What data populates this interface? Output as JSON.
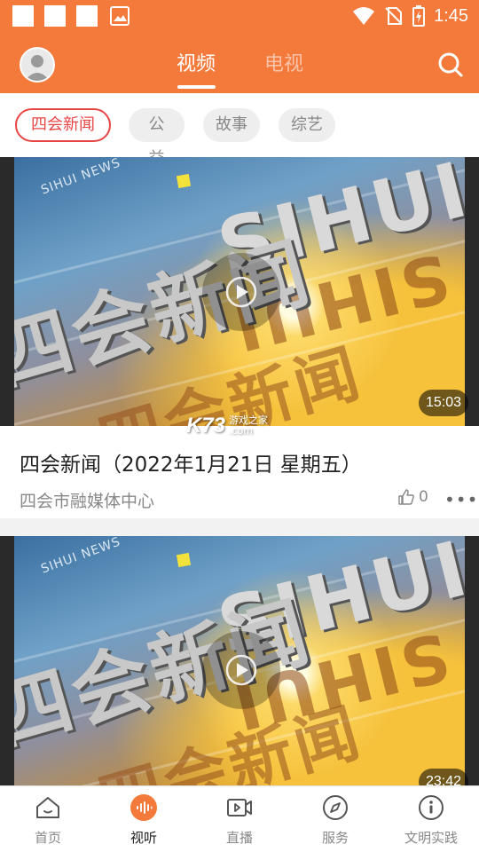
{
  "status_bar": {
    "time": "1:45"
  },
  "header": {
    "tabs": [
      {
        "label": "视频",
        "active": true
      },
      {
        "label": "电视",
        "active": false
      }
    ]
  },
  "categories": [
    {
      "label": "四会新闻",
      "active": true
    },
    {
      "label": "公益",
      "active": false
    },
    {
      "label": "故事",
      "active": false
    },
    {
      "label": "综艺",
      "active": false
    }
  ],
  "videos": [
    {
      "thumbnail_text": "四会新闻",
      "thumbnail_text_en": "SIHUI",
      "thumbnail_caption": "SIHUI NEWS",
      "duration": "15:03",
      "title": "四会新闻（2022年1月21日 星期五）",
      "source": "四会市融媒体中心",
      "likes": "0"
    },
    {
      "thumbnail_text": "四会新闻",
      "thumbnail_text_en": "SIHUI",
      "thumbnail_caption": "SIHUI NEWS",
      "duration": "23:42"
    }
  ],
  "watermark": {
    "logo": "K73",
    "text_line1": "游戏之家",
    "text_line2": ".com"
  },
  "bottom_nav": [
    {
      "label": "首页",
      "icon": "home-icon",
      "active": false
    },
    {
      "label": "视听",
      "icon": "audio-wave-icon",
      "active": true
    },
    {
      "label": "直播",
      "icon": "live-video-icon",
      "active": false
    },
    {
      "label": "服务",
      "icon": "compass-icon",
      "active": false
    },
    {
      "label": "文明实践",
      "icon": "info-icon",
      "active": false
    }
  ],
  "colors": {
    "brand_orange": "#f47a3c",
    "active_red": "#e84545"
  }
}
